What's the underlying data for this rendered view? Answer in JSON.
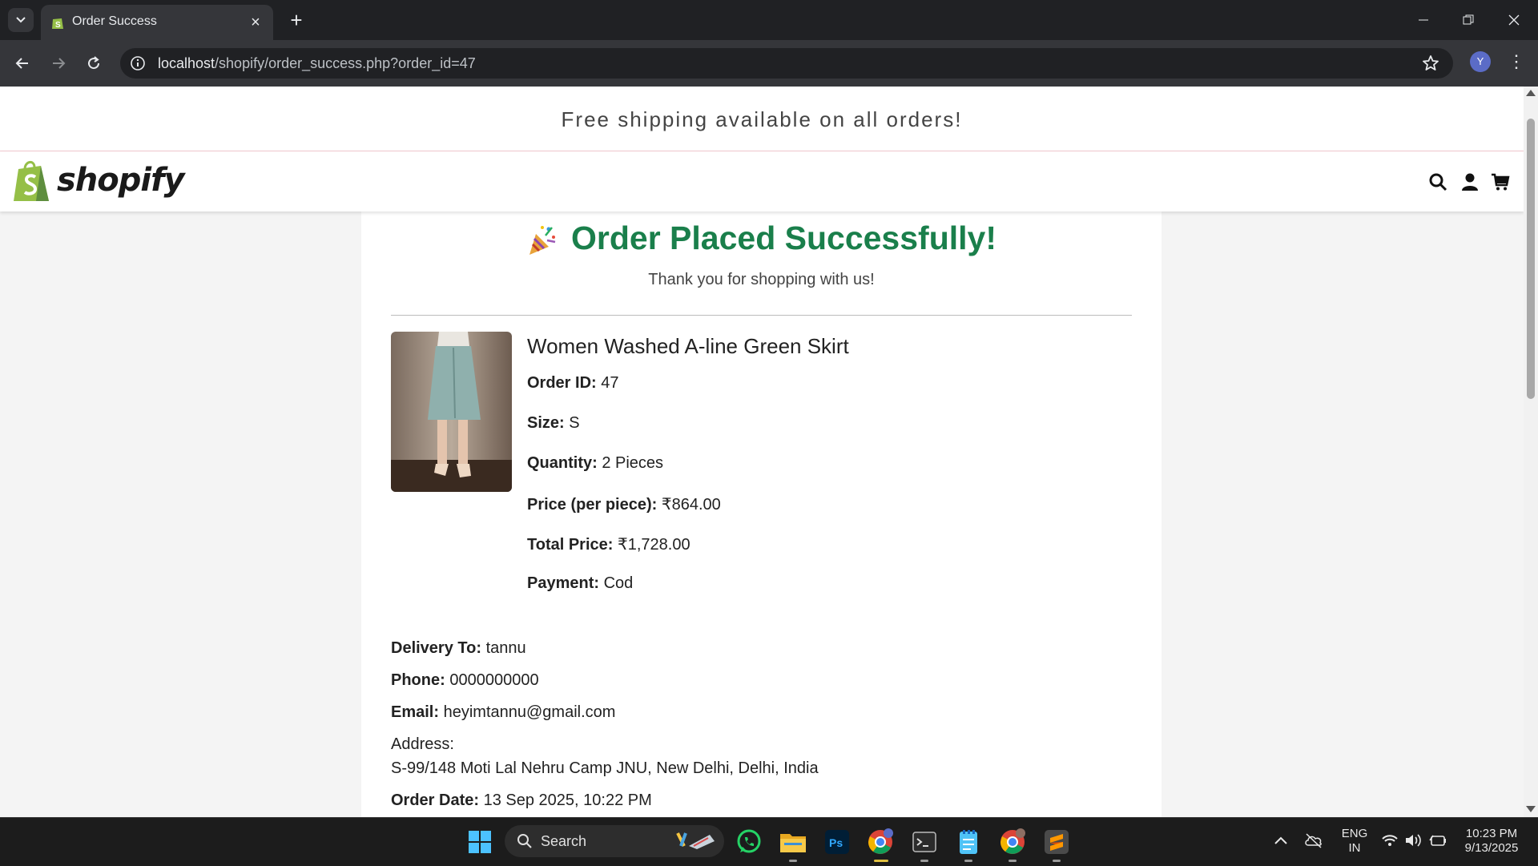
{
  "browser": {
    "tab_title": "Order Success",
    "url_host": "localhost",
    "url_path": "/shopify/order_success.php?order_id=47",
    "profile_initial": "Y"
  },
  "site": {
    "announcement": "Free shipping available on all orders!",
    "logo_text": "shopify",
    "accent_color": "#1a7f4b"
  },
  "order": {
    "success_title": "Order Placed Successfully!",
    "thanks_text": "Thank you for shopping with us!",
    "product_name": "Women Washed A-line Green Skirt",
    "details": [
      {
        "label": "Order ID:",
        "value": "47"
      },
      {
        "label": "Size:",
        "value": "S"
      },
      {
        "label": "Quantity:",
        "value": "2 Pieces"
      },
      {
        "label": "Price (per piece):",
        "value": "₹864.00"
      },
      {
        "label": "Total Price:",
        "value": "₹1,728.00"
      },
      {
        "label": "Payment:",
        "value": "Cod"
      }
    ],
    "delivery": {
      "to_label": "Delivery To:",
      "to_value": "tannu",
      "phone_label": "Phone:",
      "phone_value": "0000000000",
      "email_label": "Email:",
      "email_value": "heyimtannu@gmail.com",
      "address_label": "Address:",
      "address_value": "S-99/148 Moti Lal Nehru Camp JNU, New Delhi, Delhi, India",
      "date_label": "Order Date:",
      "date_value": "13 Sep 2025, 10:22 PM"
    }
  },
  "taskbar": {
    "search_label": "Search",
    "lang_top": "ENG",
    "lang_bottom": "IN",
    "time": "10:23 PM",
    "date": "9/13/2025"
  }
}
